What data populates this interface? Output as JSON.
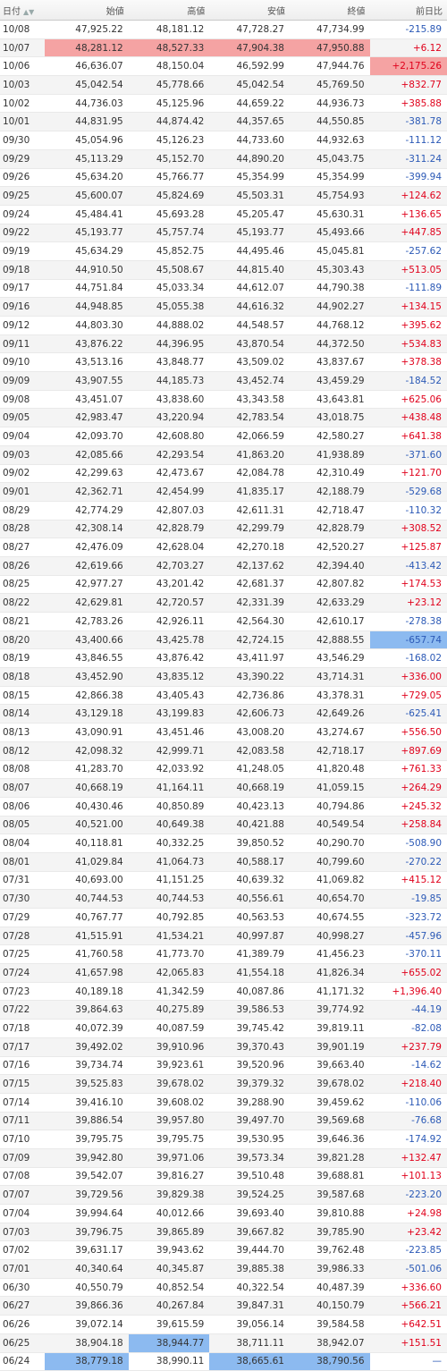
{
  "header": {
    "date": "日付",
    "open": "始値",
    "high": "高値",
    "low": "安値",
    "close": "終値",
    "change": "前日比",
    "sort_icon": "sort-asc-desc-icon"
  },
  "colors": {
    "up": "#e0001b",
    "down": "#2b59b6",
    "highlight_up": "#f5a3a3",
    "highlight_down": "#8cbaf0"
  },
  "rows": [
    {
      "date": "10/08",
      "open": "47,925.22",
      "high": "48,181.12",
      "low": "47,728.27",
      "close": "47,734.99",
      "change": "-215.89"
    },
    {
      "date": "10/07",
      "open": "48,281.12",
      "high": "48,527.33",
      "low": "47,904.38",
      "close": "47,950.88",
      "change": "+6.12",
      "hl": {
        "open": "red",
        "high": "red",
        "low": "red",
        "close": "red"
      }
    },
    {
      "date": "10/06",
      "open": "46,636.07",
      "high": "48,150.04",
      "low": "46,592.99",
      "close": "47,944.76",
      "change": "+2,175.26",
      "hl": {
        "change": "red"
      }
    },
    {
      "date": "10/03",
      "open": "45,042.54",
      "high": "45,778.66",
      "low": "45,042.54",
      "close": "45,769.50",
      "change": "+832.77"
    },
    {
      "date": "10/02",
      "open": "44,736.03",
      "high": "45,125.96",
      "low": "44,659.22",
      "close": "44,936.73",
      "change": "+385.88"
    },
    {
      "date": "10/01",
      "open": "44,831.95",
      "high": "44,874.42",
      "low": "44,357.65",
      "close": "44,550.85",
      "change": "-381.78"
    },
    {
      "date": "09/30",
      "open": "45,054.96",
      "high": "45,126.23",
      "low": "44,733.60",
      "close": "44,932.63",
      "change": "-111.12"
    },
    {
      "date": "09/29",
      "open": "45,113.29",
      "high": "45,152.70",
      "low": "44,890.20",
      "close": "45,043.75",
      "change": "-311.24"
    },
    {
      "date": "09/26",
      "open": "45,634.20",
      "high": "45,766.77",
      "low": "45,354.99",
      "close": "45,354.99",
      "change": "-399.94"
    },
    {
      "date": "09/25",
      "open": "45,600.07",
      "high": "45,824.69",
      "low": "45,503.31",
      "close": "45,754.93",
      "change": "+124.62"
    },
    {
      "date": "09/24",
      "open": "45,484.41",
      "high": "45,693.28",
      "low": "45,205.47",
      "close": "45,630.31",
      "change": "+136.65"
    },
    {
      "date": "09/22",
      "open": "45,193.77",
      "high": "45,757.74",
      "low": "45,193.77",
      "close": "45,493.66",
      "change": "+447.85"
    },
    {
      "date": "09/19",
      "open": "45,634.29",
      "high": "45,852.75",
      "low": "44,495.46",
      "close": "45,045.81",
      "change": "-257.62"
    },
    {
      "date": "09/18",
      "open": "44,910.50",
      "high": "45,508.67",
      "low": "44,815.40",
      "close": "45,303.43",
      "change": "+513.05"
    },
    {
      "date": "09/17",
      "open": "44,751.84",
      "high": "45,033.34",
      "low": "44,612.07",
      "close": "44,790.38",
      "change": "-111.89"
    },
    {
      "date": "09/16",
      "open": "44,948.85",
      "high": "45,055.38",
      "low": "44,616.32",
      "close": "44,902.27",
      "change": "+134.15"
    },
    {
      "date": "09/12",
      "open": "44,803.30",
      "high": "44,888.02",
      "low": "44,548.57",
      "close": "44,768.12",
      "change": "+395.62"
    },
    {
      "date": "09/11",
      "open": "43,876.22",
      "high": "44,396.95",
      "low": "43,870.54",
      "close": "44,372.50",
      "change": "+534.83"
    },
    {
      "date": "09/10",
      "open": "43,513.16",
      "high": "43,848.77",
      "low": "43,509.02",
      "close": "43,837.67",
      "change": "+378.38"
    },
    {
      "date": "09/09",
      "open": "43,907.55",
      "high": "44,185.73",
      "low": "43,452.74",
      "close": "43,459.29",
      "change": "-184.52"
    },
    {
      "date": "09/08",
      "open": "43,451.07",
      "high": "43,838.60",
      "low": "43,343.58",
      "close": "43,643.81",
      "change": "+625.06"
    },
    {
      "date": "09/05",
      "open": "42,983.47",
      "high": "43,220.94",
      "low": "42,783.54",
      "close": "43,018.75",
      "change": "+438.48"
    },
    {
      "date": "09/04",
      "open": "42,093.70",
      "high": "42,608.80",
      "low": "42,066.59",
      "close": "42,580.27",
      "change": "+641.38"
    },
    {
      "date": "09/03",
      "open": "42,085.66",
      "high": "42,293.54",
      "low": "41,863.20",
      "close": "41,938.89",
      "change": "-371.60"
    },
    {
      "date": "09/02",
      "open": "42,299.63",
      "high": "42,473.67",
      "low": "42,084.78",
      "close": "42,310.49",
      "change": "+121.70"
    },
    {
      "date": "09/01",
      "open": "42,362.71",
      "high": "42,454.99",
      "low": "41,835.17",
      "close": "42,188.79",
      "change": "-529.68"
    },
    {
      "date": "08/29",
      "open": "42,774.29",
      "high": "42,807.03",
      "low": "42,611.31",
      "close": "42,718.47",
      "change": "-110.32"
    },
    {
      "date": "08/28",
      "open": "42,308.14",
      "high": "42,828.79",
      "low": "42,299.79",
      "close": "42,828.79",
      "change": "+308.52"
    },
    {
      "date": "08/27",
      "open": "42,476.09",
      "high": "42,628.04",
      "low": "42,270.18",
      "close": "42,520.27",
      "change": "+125.87"
    },
    {
      "date": "08/26",
      "open": "42,619.66",
      "high": "42,703.27",
      "low": "42,137.62",
      "close": "42,394.40",
      "change": "-413.42"
    },
    {
      "date": "08/25",
      "open": "42,977.27",
      "high": "43,201.42",
      "low": "42,681.37",
      "close": "42,807.82",
      "change": "+174.53"
    },
    {
      "date": "08/22",
      "open": "42,629.81",
      "high": "42,720.57",
      "low": "42,331.39",
      "close": "42,633.29",
      "change": "+23.12"
    },
    {
      "date": "08/21",
      "open": "42,783.26",
      "high": "42,926.11",
      "low": "42,564.30",
      "close": "42,610.17",
      "change": "-278.38"
    },
    {
      "date": "08/20",
      "open": "43,400.66",
      "high": "43,425.78",
      "low": "42,724.15",
      "close": "42,888.55",
      "change": "-657.74",
      "hl": {
        "change": "blue"
      }
    },
    {
      "date": "08/19",
      "open": "43,846.55",
      "high": "43,876.42",
      "low": "43,411.97",
      "close": "43,546.29",
      "change": "-168.02"
    },
    {
      "date": "08/18",
      "open": "43,452.90",
      "high": "43,835.12",
      "low": "43,390.22",
      "close": "43,714.31",
      "change": "+336.00"
    },
    {
      "date": "08/15",
      "open": "42,866.38",
      "high": "43,405.43",
      "low": "42,736.86",
      "close": "43,378.31",
      "change": "+729.05"
    },
    {
      "date": "08/14",
      "open": "43,129.18",
      "high": "43,199.83",
      "low": "42,606.73",
      "close": "42,649.26",
      "change": "-625.41"
    },
    {
      "date": "08/13",
      "open": "43,090.91",
      "high": "43,451.46",
      "low": "43,008.20",
      "close": "43,274.67",
      "change": "+556.50"
    },
    {
      "date": "08/12",
      "open": "42,098.32",
      "high": "42,999.71",
      "low": "42,083.58",
      "close": "42,718.17",
      "change": "+897.69"
    },
    {
      "date": "08/08",
      "open": "41,283.70",
      "high": "42,033.92",
      "low": "41,248.05",
      "close": "41,820.48",
      "change": "+761.33"
    },
    {
      "date": "08/07",
      "open": "40,668.19",
      "high": "41,164.11",
      "low": "40,668.19",
      "close": "41,059.15",
      "change": "+264.29"
    },
    {
      "date": "08/06",
      "open": "40,430.46",
      "high": "40,850.89",
      "low": "40,423.13",
      "close": "40,794.86",
      "change": "+245.32"
    },
    {
      "date": "08/05",
      "open": "40,521.00",
      "high": "40,649.38",
      "low": "40,421.88",
      "close": "40,549.54",
      "change": "+258.84"
    },
    {
      "date": "08/04",
      "open": "40,118.81",
      "high": "40,332.25",
      "low": "39,850.52",
      "close": "40,290.70",
      "change": "-508.90"
    },
    {
      "date": "08/01",
      "open": "41,029.84",
      "high": "41,064.73",
      "low": "40,588.17",
      "close": "40,799.60",
      "change": "-270.22"
    },
    {
      "date": "07/31",
      "open": "40,693.00",
      "high": "41,151.25",
      "low": "40,639.32",
      "close": "41,069.82",
      "change": "+415.12"
    },
    {
      "date": "07/30",
      "open": "40,744.53",
      "high": "40,744.53",
      "low": "40,556.61",
      "close": "40,654.70",
      "change": "-19.85"
    },
    {
      "date": "07/29",
      "open": "40,767.77",
      "high": "40,792.85",
      "low": "40,563.53",
      "close": "40,674.55",
      "change": "-323.72"
    },
    {
      "date": "07/28",
      "open": "41,515.91",
      "high": "41,534.21",
      "low": "40,997.87",
      "close": "40,998.27",
      "change": "-457.96"
    },
    {
      "date": "07/25",
      "open": "41,760.58",
      "high": "41,773.70",
      "low": "41,389.79",
      "close": "41,456.23",
      "change": "-370.11"
    },
    {
      "date": "07/24",
      "open": "41,657.98",
      "high": "42,065.83",
      "low": "41,554.18",
      "close": "41,826.34",
      "change": "+655.02"
    },
    {
      "date": "07/23",
      "open": "40,189.18",
      "high": "41,342.59",
      "low": "40,087.86",
      "close": "41,171.32",
      "change": "+1,396.40"
    },
    {
      "date": "07/22",
      "open": "39,864.63",
      "high": "40,275.89",
      "low": "39,586.53",
      "close": "39,774.92",
      "change": "-44.19"
    },
    {
      "date": "07/18",
      "open": "40,072.39",
      "high": "40,087.59",
      "low": "39,745.42",
      "close": "39,819.11",
      "change": "-82.08"
    },
    {
      "date": "07/17",
      "open": "39,492.02",
      "high": "39,910.96",
      "low": "39,370.43",
      "close": "39,901.19",
      "change": "+237.79"
    },
    {
      "date": "07/16",
      "open": "39,734.74",
      "high": "39,923.61",
      "low": "39,520.96",
      "close": "39,663.40",
      "change": "-14.62"
    },
    {
      "date": "07/15",
      "open": "39,525.83",
      "high": "39,678.02",
      "low": "39,379.32",
      "close": "39,678.02",
      "change": "+218.40"
    },
    {
      "date": "07/14",
      "open": "39,416.10",
      "high": "39,608.02",
      "low": "39,288.90",
      "close": "39,459.62",
      "change": "-110.06"
    },
    {
      "date": "07/11",
      "open": "39,886.54",
      "high": "39,957.80",
      "low": "39,497.70",
      "close": "39,569.68",
      "change": "-76.68"
    },
    {
      "date": "07/10",
      "open": "39,795.75",
      "high": "39,795.75",
      "low": "39,530.95",
      "close": "39,646.36",
      "change": "-174.92"
    },
    {
      "date": "07/09",
      "open": "39,942.80",
      "high": "39,971.06",
      "low": "39,573.34",
      "close": "39,821.28",
      "change": "+132.47"
    },
    {
      "date": "07/08",
      "open": "39,542.07",
      "high": "39,816.27",
      "low": "39,510.48",
      "close": "39,688.81",
      "change": "+101.13"
    },
    {
      "date": "07/07",
      "open": "39,729.56",
      "high": "39,829.38",
      "low": "39,524.25",
      "close": "39,587.68",
      "change": "-223.20"
    },
    {
      "date": "07/04",
      "open": "39,994.64",
      "high": "40,012.66",
      "low": "39,693.40",
      "close": "39,810.88",
      "change": "+24.98"
    },
    {
      "date": "07/03",
      "open": "39,796.75",
      "high": "39,865.89",
      "low": "39,667.82",
      "close": "39,785.90",
      "change": "+23.42"
    },
    {
      "date": "07/02",
      "open": "39,631.17",
      "high": "39,943.62",
      "low": "39,444.70",
      "close": "39,762.48",
      "change": "-223.85"
    },
    {
      "date": "07/01",
      "open": "40,340.64",
      "high": "40,345.87",
      "low": "39,885.38",
      "close": "39,986.33",
      "change": "-501.06"
    },
    {
      "date": "06/30",
      "open": "40,550.79",
      "high": "40,852.54",
      "low": "40,322.54",
      "close": "40,487.39",
      "change": "+336.60"
    },
    {
      "date": "06/27",
      "open": "39,866.36",
      "high": "40,267.84",
      "low": "39,847.31",
      "close": "40,150.79",
      "change": "+566.21"
    },
    {
      "date": "06/26",
      "open": "39,072.14",
      "high": "39,615.59",
      "low": "39,056.14",
      "close": "39,584.58",
      "change": "+642.51"
    },
    {
      "date": "06/25",
      "open": "38,904.18",
      "high": "38,944.77",
      "low": "38,711.11",
      "close": "38,942.07",
      "change": "+151.51",
      "hl": {
        "high": "blue"
      }
    },
    {
      "date": "06/24",
      "open": "38,779.18",
      "high": "38,990.11",
      "low": "38,665.61",
      "close": "38,790.56",
      "change": "—",
      "hl": {
        "open": "blue",
        "low": "blue",
        "close": "blue"
      }
    }
  ]
}
